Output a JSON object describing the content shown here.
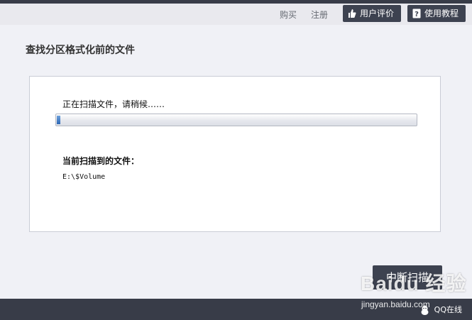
{
  "header": {
    "buy_label": "购买",
    "register_label": "注册",
    "user_review_label": "用户评价",
    "tutorial_label": "使用教程"
  },
  "main": {
    "title": "查找分区格式化前的文件",
    "scan_status": "正在扫描文件，请稍候……",
    "progress": 0.01,
    "current_file_label": "当前扫描到的文件：",
    "current_file_path": "E:\\$Volume",
    "stop_button_label": "中断扫描"
  },
  "footer": {
    "qq_label": "QQ在线"
  },
  "watermark": {
    "logo_text": "Baidu 经验",
    "url_text": "jingyan.baidu.com"
  },
  "colors": {
    "dark_bar": "#383c48",
    "button_bg": "#3d4250",
    "progress_fill": "#2c67b4",
    "background": "#f0f1f6"
  }
}
